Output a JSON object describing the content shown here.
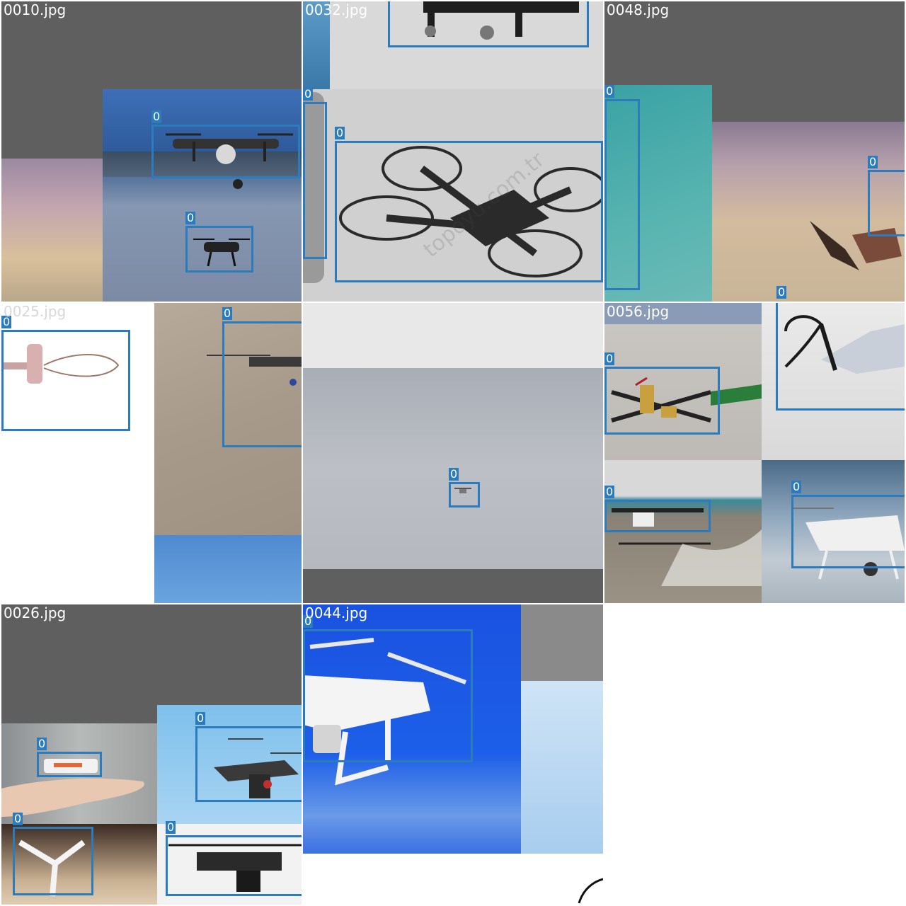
{
  "mosaic": {
    "tiles": [
      {
        "filename": "0010.jpg",
        "labels": [
          "0",
          "0"
        ]
      },
      {
        "filename": "0032.jpg",
        "labels": [
          "0",
          "0"
        ],
        "watermark": "topoyu.com.tr"
      },
      {
        "filename": "0048.jpg",
        "labels": [
          "0",
          "0",
          "0"
        ]
      },
      {
        "filename": "0025.jpg",
        "labels": [
          "0",
          "0"
        ]
      },
      {
        "filename": "",
        "labels": [
          "0"
        ]
      },
      {
        "filename": "0056.jpg",
        "labels": [
          "0",
          "0",
          "0",
          "0"
        ]
      },
      {
        "filename": "0026.jpg",
        "labels": [
          "0",
          "0",
          "0",
          "0"
        ]
      },
      {
        "filename": "0044.jpg",
        "labels": [
          "0"
        ]
      }
    ]
  },
  "colors": {
    "box": "#2c7bbd",
    "pad": "#5f5f5f"
  }
}
